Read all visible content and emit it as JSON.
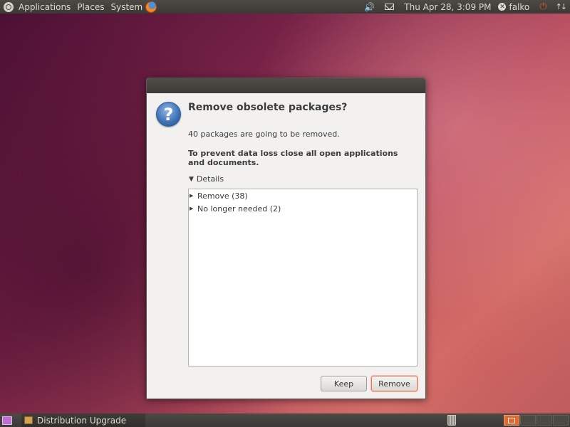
{
  "top_panel": {
    "menus": [
      "Applications",
      "Places",
      "System"
    ],
    "volume_icon": "volume-icon",
    "mail_icon": "mail-icon",
    "clock": "Thu Apr 28,  3:09 PM",
    "user_name": "falko",
    "power_icon": "power-icon",
    "transfer_icon": "network-transfer-icon"
  },
  "dialog": {
    "icon": "question-icon",
    "title": "Remove obsolete packages?",
    "message": "40 packages are going to be removed.",
    "warning": "To prevent data loss close all open applications and documents.",
    "details_label": "Details",
    "details_expanded": true,
    "tree_items": [
      {
        "label": "Remove (38)",
        "expanded": false
      },
      {
        "label": "No longer needed (2)",
        "expanded": false
      }
    ],
    "buttons": {
      "keep": "Keep",
      "remove": "Remove"
    }
  },
  "bottom_panel": {
    "task_label": "Distribution Upgrade",
    "trash_icon": "trash-icon",
    "active_workspace": 1
  },
  "colors": {
    "panel": "#3a3935",
    "dialog_bg": "#f2f1f0",
    "accent": "#e0692f",
    "power": "#e04a2a",
    "question_icon": "#3c6fb5"
  }
}
